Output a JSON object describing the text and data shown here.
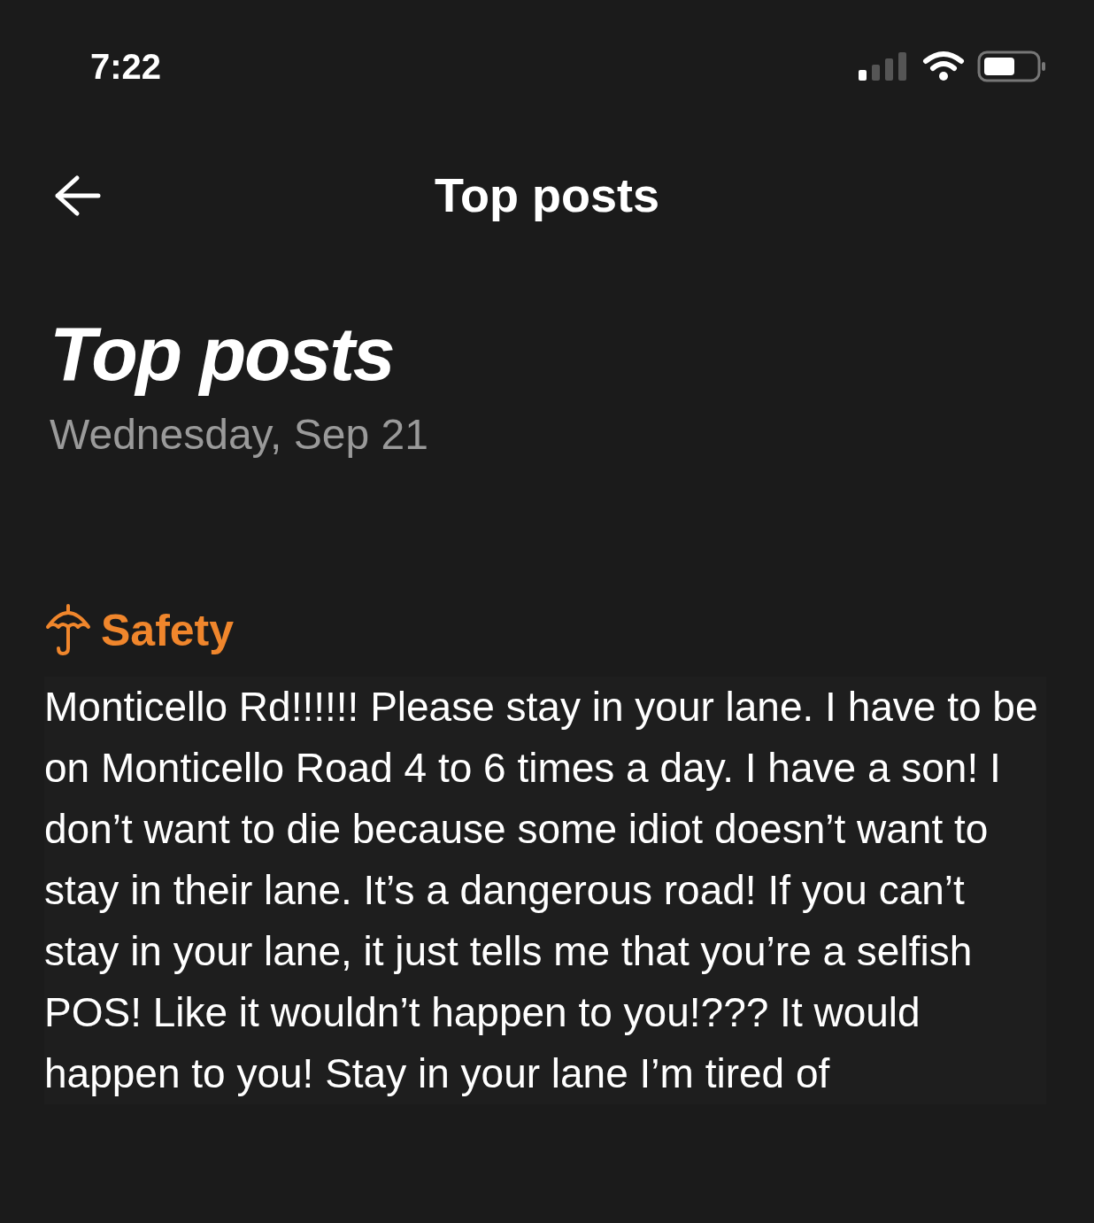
{
  "status_bar": {
    "time": "7:22"
  },
  "nav": {
    "title": "Top posts"
  },
  "header": {
    "title": "Top posts",
    "date": "Wednesday, Sep 21"
  },
  "post": {
    "category": "Safety",
    "color": "#f0862c",
    "text": "Monticello Rd!!!!!! Please stay in your lane. I have to be on Monticello Road 4 to 6 times a day. I have a son! I don’t want to die because some idiot doesn’t want to stay in their lane. It’s a dangerous road! If you can’t stay in your lane, it just tells me that you’re a selfish POS! Like it wouldn’t happen to you!??? It would happen to you! Stay in your lane I’m tired of"
  }
}
